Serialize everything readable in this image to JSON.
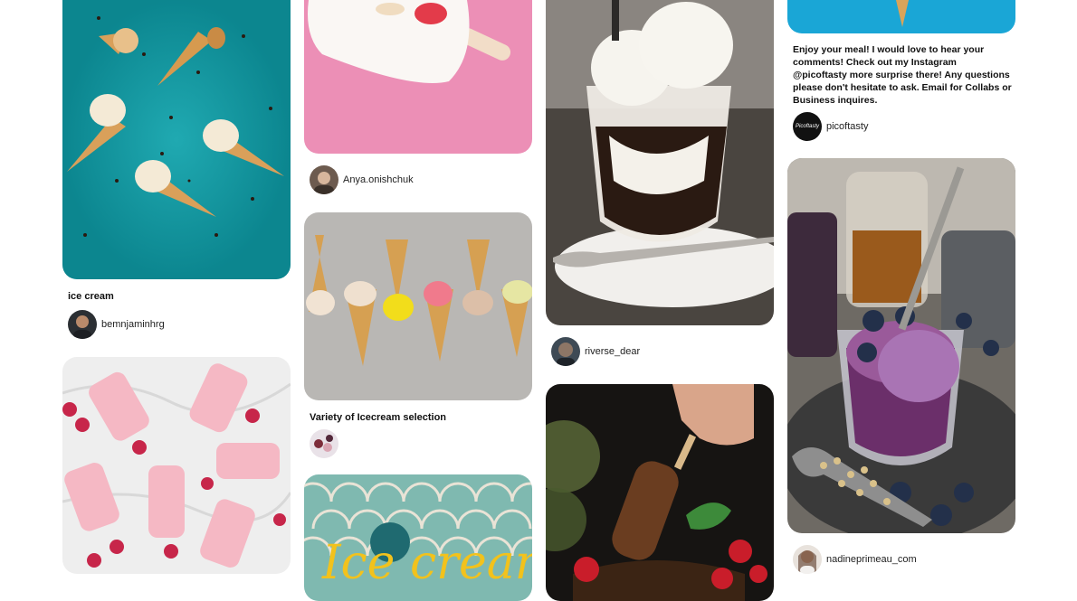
{
  "pins": [
    {
      "id": "p1",
      "title": "ice cream",
      "author": "bemnjaminhrg",
      "image": "ice-cream-cones-on-teal"
    },
    {
      "id": "p2",
      "title": "",
      "author": "",
      "image": "raspberry-popsicles-on-marble"
    },
    {
      "id": "p3",
      "title": "",
      "author": "Anya.onishchuk",
      "image": "white-popsicle-on-pink"
    },
    {
      "id": "p4",
      "title": "Variety of Icecream selection",
      "author": "",
      "image": "ice-cream-cones-on-grey"
    },
    {
      "id": "p5",
      "title": "",
      "author": "",
      "image": "ice-cream-lettering-sign",
      "image_text": "Ice cream"
    },
    {
      "id": "p6",
      "title": "",
      "author": "riverse_dear",
      "image": "coffee-jelly-ice-cream-glass"
    },
    {
      "id": "p7",
      "title": "",
      "author": "",
      "image": "chocolate-ice-cream-bars"
    },
    {
      "id": "p8",
      "description": "Enjoy your meal! I would love to hear your comments! Check out my Instagram @picoftasty more surprise there! Any questions please don't hesitate to ask. Email for Collabs or Business inquires.",
      "author": "picoftasty",
      "avatar_text": "Picoftasty",
      "image": "teal-photo-with-cone"
    },
    {
      "id": "p9",
      "title": "",
      "author": "nadineprimeau_com",
      "image": "blueberry-ice-cream-glass"
    }
  ]
}
